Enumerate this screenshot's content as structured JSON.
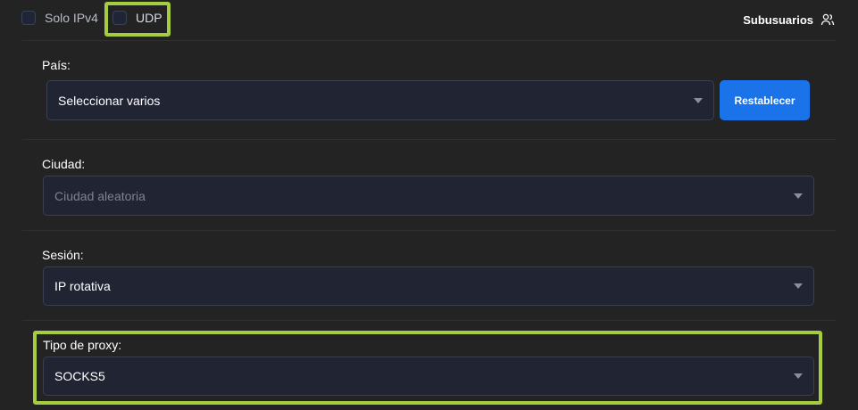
{
  "filters": {
    "ipv4_label": "Solo IPv4",
    "udp_label": "UDP"
  },
  "header": {
    "subusers_label": "Subusuarios"
  },
  "country": {
    "label": "País:",
    "value": "Seleccionar varios",
    "reset_label": "Restablecer"
  },
  "city": {
    "label": "Ciudad:",
    "placeholder": "Ciudad aleatoria"
  },
  "session": {
    "label": "Sesión:",
    "value": "IP rotativa"
  },
  "proxy_type": {
    "label": "Tipo de proxy:",
    "value": "SOCKS5"
  },
  "colors": {
    "background": "#232323",
    "field_bg": "#202433",
    "accent_blue": "#1a73e8",
    "highlight_green": "#a6cc3f"
  },
  "icons": [
    "users-icon",
    "chevron-down-icon"
  ]
}
